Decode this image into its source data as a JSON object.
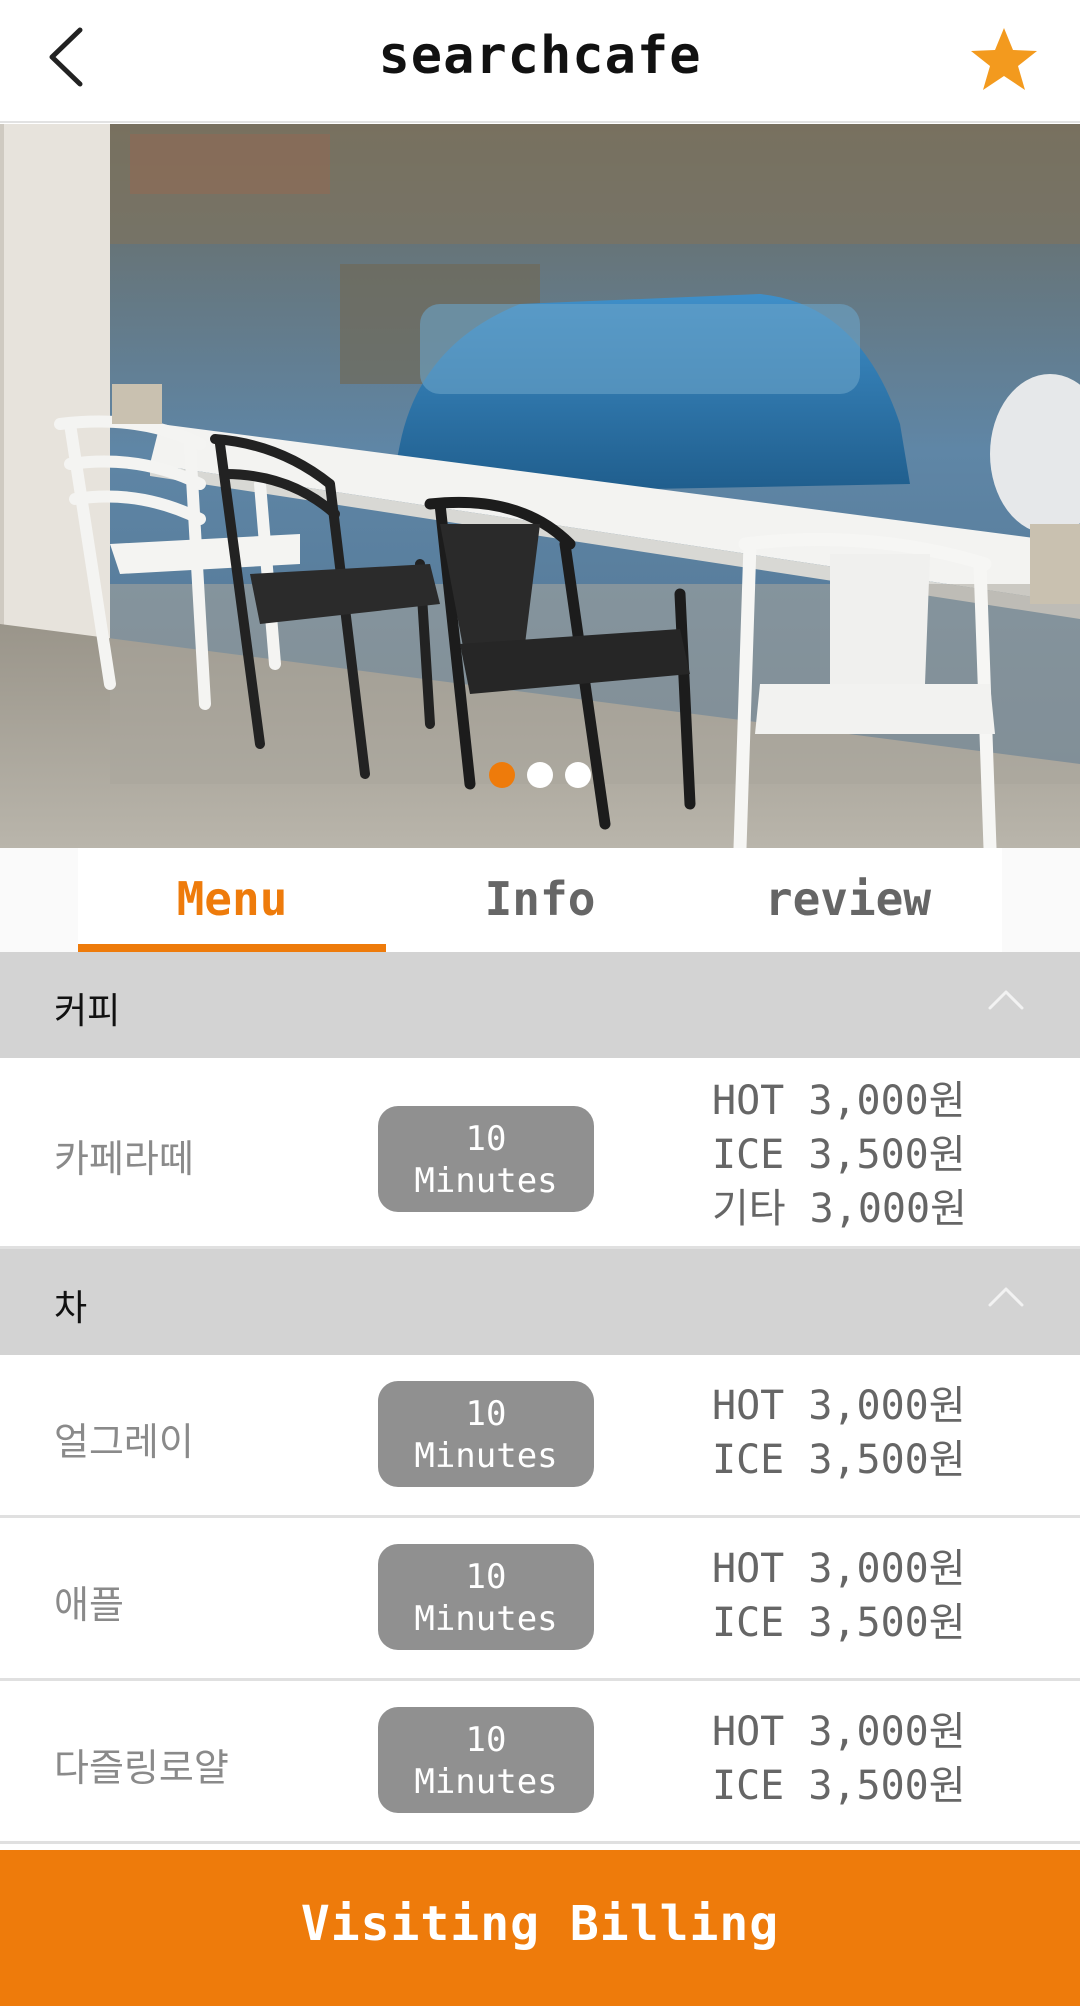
{
  "header": {
    "title": "searchcafe",
    "back_icon": "chevron-left-icon",
    "favorite_icon": "star-icon",
    "favorite_color": "#f39a1e"
  },
  "carousel": {
    "slide_count": 3,
    "active_index": 0,
    "active_color": "#ee7b0b"
  },
  "tabs": [
    {
      "label": "Menu",
      "active": true
    },
    {
      "label": "Info",
      "active": false
    },
    {
      "label": "review",
      "active": false
    }
  ],
  "categories": [
    {
      "label": "커피",
      "expanded": true,
      "items": [
        {
          "name": "카페라떼",
          "time_value": "10",
          "time_unit": "Minutes",
          "prices": [
            "HOT 3,000원",
            "ICE 3,500원",
            "기타 3,000원"
          ]
        }
      ]
    },
    {
      "label": "차",
      "expanded": true,
      "items": [
        {
          "name": "얼그레이",
          "time_value": "10",
          "time_unit": "Minutes",
          "prices": [
            "HOT 3,000원",
            "ICE 3,500원"
          ]
        },
        {
          "name": "애플",
          "time_value": "10",
          "time_unit": "Minutes",
          "prices": [
            "HOT 3,000원",
            "ICE 3,500원"
          ]
        },
        {
          "name": "다즐링로얄",
          "time_value": "10",
          "time_unit": "Minutes",
          "prices": [
            "HOT 3,000원",
            "ICE 3,500원"
          ]
        }
      ]
    }
  ],
  "footer": {
    "button_label": "Visiting Billing",
    "accent_color": "#ee7b0b"
  }
}
